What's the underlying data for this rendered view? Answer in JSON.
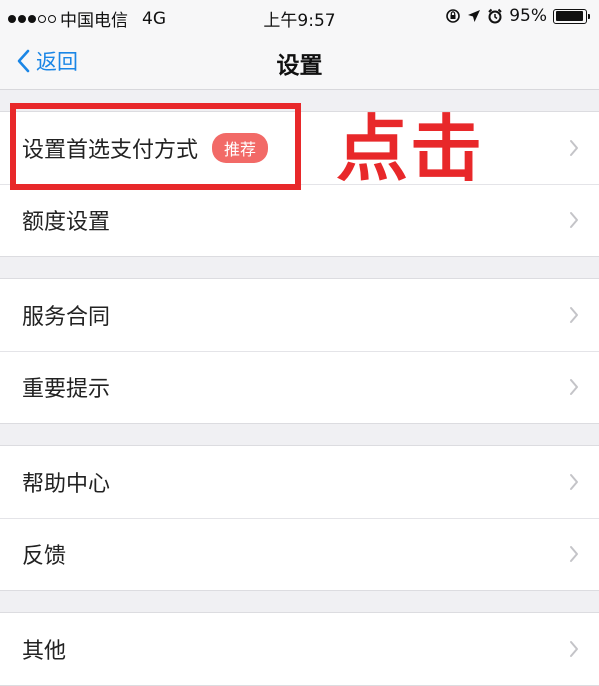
{
  "status_bar": {
    "carrier": "中国电信",
    "network": "4G",
    "time": "上午9:57",
    "battery_percent": "95%",
    "battery_level": 0.95
  },
  "nav": {
    "back_label": "返回",
    "title": "设置"
  },
  "groups": [
    {
      "items": [
        {
          "label": "设置首选支付方式",
          "badge": "推荐"
        },
        {
          "label": "额度设置"
        }
      ]
    },
    {
      "items": [
        {
          "label": "服务合同"
        },
        {
          "label": "重要提示"
        }
      ]
    },
    {
      "items": [
        {
          "label": "帮助中心"
        },
        {
          "label": "反馈"
        }
      ]
    },
    {
      "items": [
        {
          "label": "其他"
        }
      ]
    }
  ],
  "annotation": {
    "text": "点击"
  },
  "colors": {
    "accent": "#1a86e6",
    "badge": "#f26a67",
    "annotation": "#e8282a"
  }
}
